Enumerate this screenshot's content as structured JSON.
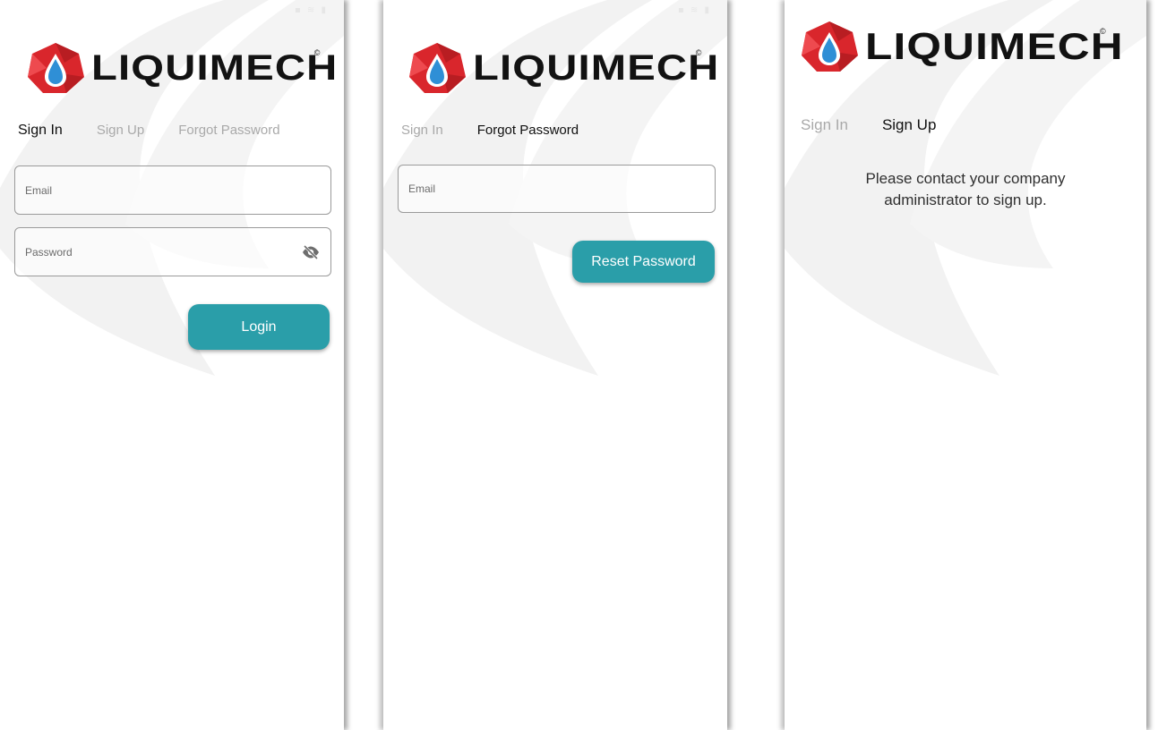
{
  "brand": {
    "name": "LIQUIMECH",
    "registered_mark": "©"
  },
  "colors": {
    "accent": "#2a9ea9",
    "logo_red": "#d9262c",
    "logo_blue": "#2f8fd6",
    "watermark": "#f1f1f1"
  },
  "screen_sign_in": {
    "tabs": [
      {
        "label": "Sign In",
        "active": true
      },
      {
        "label": "Sign Up",
        "active": false
      },
      {
        "label": "Forgot Password",
        "active": false
      }
    ],
    "email_placeholder": "Email",
    "password_placeholder": "Password",
    "password_toggle_icon": "eye-off-icon",
    "login_label": "Login"
  },
  "screen_forgot_password": {
    "tabs": [
      {
        "label": "Sign In",
        "active": false
      },
      {
        "label": "Forgot Password",
        "active": true
      }
    ],
    "email_placeholder": "Email",
    "reset_label": "Reset Password"
  },
  "screen_sign_up": {
    "tabs": [
      {
        "label": "Sign In",
        "active": false
      },
      {
        "label": "Sign Up",
        "active": true
      }
    ],
    "message_line1": "Please contact your company",
    "message_line2": "administrator to sign up."
  }
}
